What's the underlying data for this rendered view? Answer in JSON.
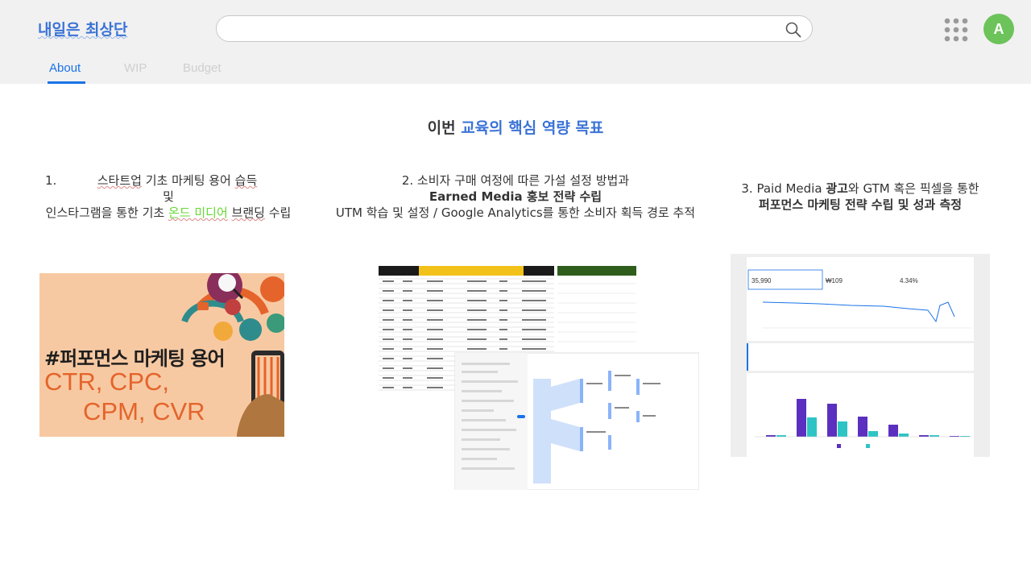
{
  "header": {
    "site_title": "내일은 최상단",
    "search": {
      "placeholder": "",
      "value": ""
    },
    "avatar_letter": "A"
  },
  "tabs": [
    {
      "label": "About",
      "active": true
    },
    {
      "label": "WIP",
      "active": false
    },
    {
      "label": "Budget",
      "active": false
    }
  ],
  "main": {
    "heading_prefix": "이번",
    "heading_highlight": "교육의 핵심 역량 목표",
    "goals": [
      {
        "number": "1.",
        "line1_a": "스타트업",
        "line1_b": " 기초 마케팅 용어 ",
        "line1_c": "습득",
        "line2": "및",
        "line3_a": "인스타그램을 통한 기초 ",
        "line3_b": "온드 미디어",
        "line3_c": " ",
        "line3_d": "브랜딩",
        "line3_e": " 수립"
      },
      {
        "line1": "2. 소비자 구매 여정에 따른 가설 설정 방법과",
        "line2": "Earned Media 홍보 전략 수립",
        "line3": "UTM 학습 및 설정 / Google Analytics를 통한 소비자 획득 경로 추적"
      },
      {
        "line1_a": "3. Paid Media ",
        "line1_b": "광고",
        "line1_c": "와 GTM 혹은 픽셀을 통한",
        "line2": "퍼포먼스 마케팅 전략 수립 및 성과 측정"
      }
    ],
    "image1": {
      "title": "#퍼포먼스 마케팅 용어",
      "line2": "CTR, CPC,",
      "line3": "CPM, CVR"
    },
    "image3": {
      "stat1_value": "35,990",
      "stat2_value": "₩109",
      "stat3_value": "4.34%"
    }
  },
  "colors": {
    "accent": "#1a73e8",
    "title_blue": "#3b73d6",
    "avatar_green": "#6cc35a",
    "highlight_green": "#66d933",
    "chart_purple": "#5b2fbf",
    "chart_teal": "#2ec4c4"
  }
}
